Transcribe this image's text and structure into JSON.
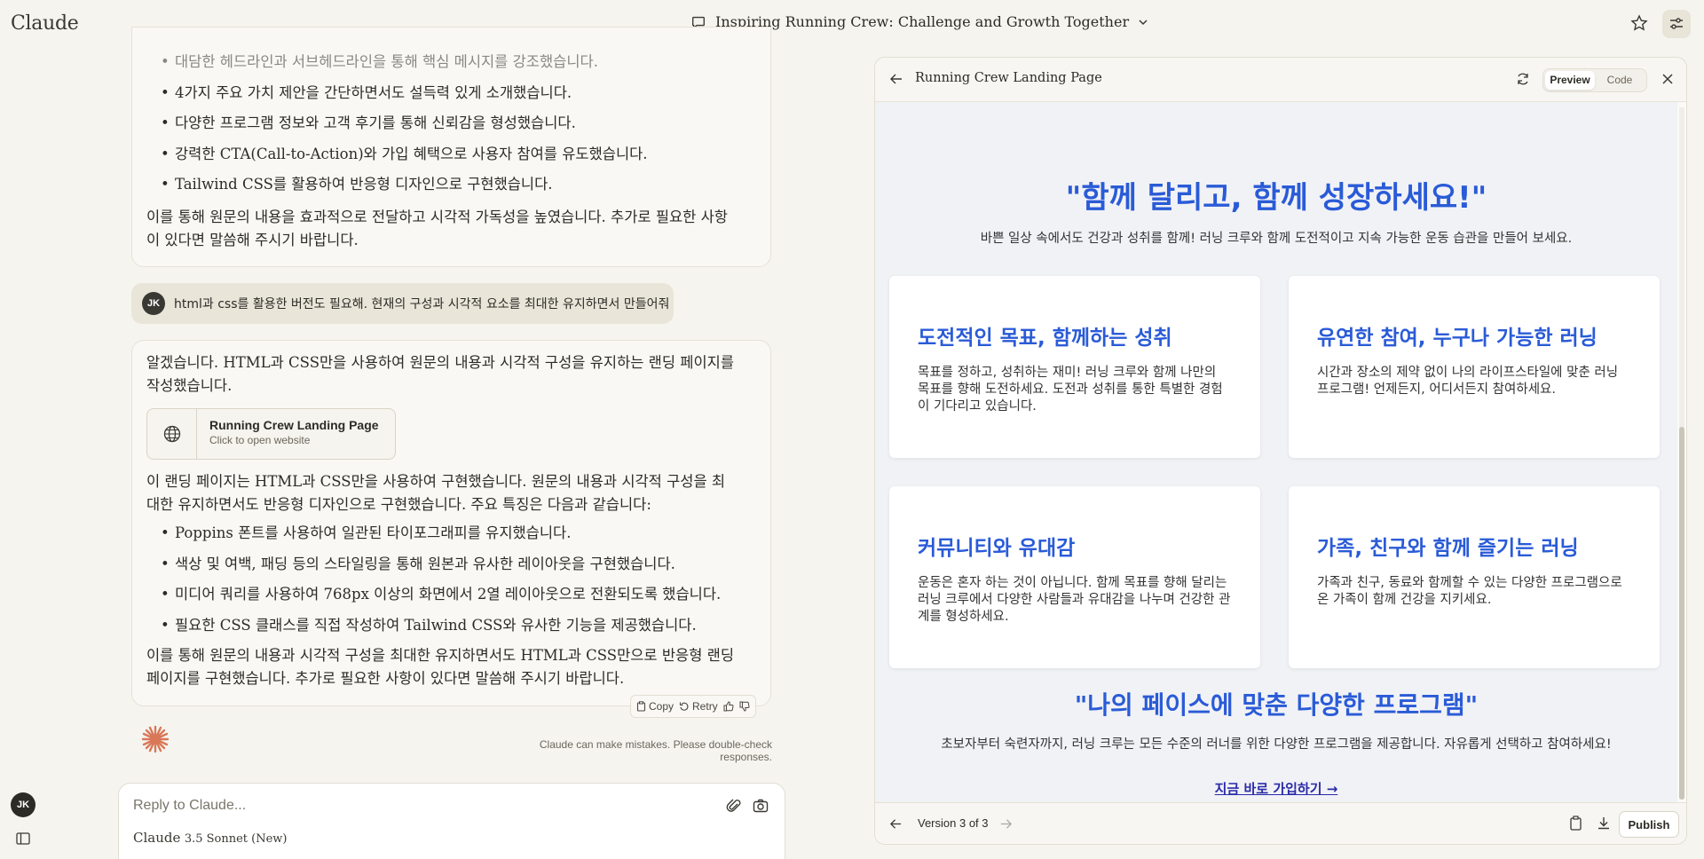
{
  "app": {
    "brand": "Claude"
  },
  "header": {
    "conversation_title": "Inspiring Running Crew: Challenge and Growth Together"
  },
  "message1": {
    "bullets": [
      "대담한 헤드라인과 서브헤드라인을 통해 핵심 메시지를 강조했습니다.",
      "4가지 주요 가치 제안을 간단하면서도 설득력 있게 소개했습니다.",
      "다양한 프로그램 정보와 고객 후기를 통해 신뢰감을 형성했습니다.",
      "강력한 CTA(Call-to-Action)와 가입 혜택으로 사용자 참여를 유도했습니다.",
      "Tailwind CSS를 활용하여 반응형 디자인으로 구현했습니다."
    ],
    "closing": "이를 통해 원문의 내용을 효과적으로 전달하고 시각적 가독성을 높였습니다. 추가로 필요한 사항이 있다면 말씀해 주시기 바랍니다."
  },
  "user_message": {
    "avatar": "JK",
    "text": "html과 css를 활용한 버전도 필요해. 현재의 구성과 시각적 요소를 최대한 유지하면서 만들어줘"
  },
  "message2": {
    "intro": "알겠습니다. HTML과 CSS만을 사용하여 원문의 내용과 시각적 구성을 유지하는 랜딩 페이지를 작성했습니다.",
    "artifact": {
      "title": "Running Crew Landing Page",
      "subtitle": "Click to open website"
    },
    "body": "이 랜딩 페이지는 HTML과 CSS만을 사용하여 구현했습니다. 원문의 내용과 시각적 구성을 최대한 유지하면서도 반응형 디자인으로 구현했습니다. 주요 특징은 다음과 같습니다:",
    "bullets": [
      "Poppins 폰트를 사용하여 일관된 타이포그래피를 유지했습니다.",
      "색상 및 여백, 패딩 등의 스타일링을 통해 원본과 유사한 레이아웃을 구현했습니다.",
      "미디어 쿼리를 사용하여 768px 이상의 화면에서 2열 레이아웃으로 전환되도록 했습니다.",
      "필요한 CSS 클래스를 직접 작성하여 Tailwind CSS와 유사한 기능을 제공했습니다."
    ],
    "closing": "이를 통해 원문의 내용과 시각적 구성을 최대한 유지하면서도 HTML과 CSS만으로 반응형 랜딩 페이지를 구현했습니다. 추가로 필요한 사항이 있다면 말씀해 주시기 바랍니다."
  },
  "actions": {
    "copy": "Copy",
    "retry": "Retry"
  },
  "disclaimer": "Claude can make mistakes. Please double-check responses.",
  "input": {
    "placeholder": "Reply to Claude...",
    "model_brand": "Claude",
    "model_name": "3.5 Sonnet (New)"
  },
  "sidebar": {
    "avatar": "JK"
  },
  "panel": {
    "title": "Running Crew Landing Page",
    "tabs": [
      "Preview",
      "Code"
    ],
    "active_tab": "Preview",
    "version": "Version 3 of 3",
    "publish": "Publish"
  },
  "landing": {
    "hero_title": "\"함께 달리고, 함께 성장하세요!\"",
    "hero_sub": "바쁜 일상 속에서도 건강과 성취를 함께! 러닝 크루와 함께 도전적이고 지속 가능한 운동 습관을 만들어 보세요.",
    "cards": [
      {
        "title": "도전적인 목표, 함께하는 성취",
        "text": "목표를 정하고, 성취하는 재미! 러닝 크루와 함께 나만의 목표를 향해 도전하세요. 도전과 성취를 통한 특별한 경험이 기다리고 있습니다."
      },
      {
        "title": "유연한 참여, 누구나 가능한 러닝",
        "text": "시간과 장소의 제약 없이 나의 라이프스타일에 맞춘 러닝 프로그램! 언제든지, 어디서든지 참여하세요."
      },
      {
        "title": "커뮤니티와 유대감",
        "text": "운동은 혼자 하는 것이 아닙니다. 함께 목표를 향해 달리는 러닝 크루에서 다양한 사람들과 유대감을 나누며 건강한 관계를 형성하세요."
      },
      {
        "title": "가족, 친구와 함께 즐기는 러닝",
        "text": "가족과 친구, 동료와 함께할 수 있는 다양한 프로그램으로 온 가족이 함께 건강을 지키세요."
      }
    ],
    "section_title": "\"나의 페이스에 맞춘 다양한 프로그램\"",
    "section_sub": "초보자부터 숙련자까지, 러닝 크루는 모든 수준의 러너를 위한 다양한 프로그램을 제공합니다. 자유롭게 선택하고 참여하세요!",
    "cta": "지금 바로 가입하기 →"
  },
  "colors": {
    "accent_blue": "#2a5bd7",
    "claude_orange": "#d97757",
    "background": "#f5f4ef"
  }
}
